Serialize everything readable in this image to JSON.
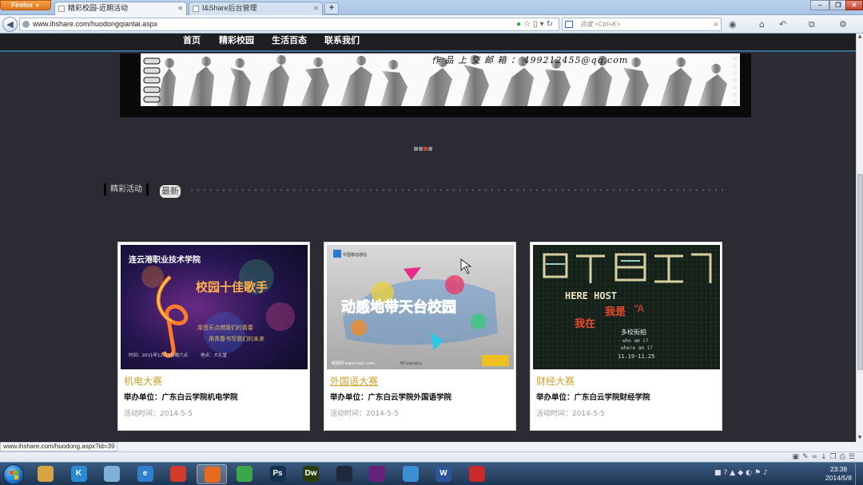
{
  "browser": {
    "menu_label": "Firefox",
    "tabs": [
      {
        "title": "精彩校园-近期活动",
        "active": true
      },
      {
        "title": "I&Share后台管理",
        "active": false
      }
    ],
    "new_tab_label": "+",
    "window_controls": {
      "minimize": "–",
      "maximize": "❐",
      "close": "✕"
    },
    "url": "www.ihshare.com/huodongqiantai.aspx",
    "search_placeholder": "百度 <Ctrl+K>",
    "status_url": "www.ihshare.com/huodong.aspx?id=39"
  },
  "site": {
    "nav": [
      "首页",
      "精彩校园",
      "生活百态",
      "联系我们"
    ],
    "banner_text": "作 品 上 交 邮 箱 ： 499212455@qq.com",
    "pager": {
      "count": 4,
      "active_index": 2
    },
    "section": {
      "title": "精彩活动",
      "tab": "最新"
    },
    "cards": [
      {
        "title": "机电大赛",
        "org": "举办单位：广东白云学院机电学院",
        "date": "活动时间：2014-5-5",
        "poster": {
          "school": "连云港职业技术学院",
          "headline": "校园十佳歌手",
          "line1": "用音乐点燃我们的青春",
          "line2": "用青春书写我们的未来",
          "time": "时间：2011年12月9日晚六点",
          "place": "地点：大礼堂"
        }
      },
      {
        "title": "外国语大赛",
        "org": "举办单位：广东白云学院外国语学院",
        "date": "活动时间：2014-5-5",
        "poster": {
          "headline": "动感地带天台校园",
          "logo_text": "中国移动通信",
          "site_text": "昵图网 www.nipic.com",
          "id_text": "BY:xiangliu"
        }
      },
      {
        "title": "财经大赛",
        "org": "举办单位：广东白云学院财经学院",
        "date": "活动时间：2014-5-5",
        "poster": {
          "big": "HERE HOST",
          "line1": "我是",
          "line2": "我在",
          "line3": "多校街拍",
          "line4": "who am i?",
          "line5": "where am i?",
          "line6": "11.19-11.25",
          "quote": "“A"
        }
      }
    ]
  },
  "taskbar": {
    "apps": [
      {
        "name": "file-explorer",
        "label": "",
        "color": "#d9a441"
      },
      {
        "name": "kugou",
        "label": "K",
        "color": "#2a8ad4"
      },
      {
        "name": "notepad",
        "label": "",
        "color": "#7fb0d8"
      },
      {
        "name": "ie",
        "label": "e",
        "color": "#2f7fd1"
      },
      {
        "name": "chrome",
        "label": "",
        "color": "#d33c2c"
      },
      {
        "name": "firefox",
        "label": "",
        "color": "#e56b1f"
      },
      {
        "name": "360",
        "label": "",
        "color": "#3aa84a"
      },
      {
        "name": "photoshop",
        "label": "Ps",
        "color": "#12324f"
      },
      {
        "name": "dreamweaver",
        "label": "Dw",
        "color": "#2c3d0c"
      },
      {
        "name": "inkscape",
        "label": "",
        "color": "#1e2a3a"
      },
      {
        "name": "visual-studio",
        "label": "",
        "color": "#68217a"
      },
      {
        "name": "network",
        "label": "",
        "color": "#3a8fd4"
      },
      {
        "name": "word",
        "label": "W",
        "color": "#2a5699"
      },
      {
        "name": "recorder",
        "label": "",
        "color": "#c82a2a"
      }
    ],
    "active_app": "firefox",
    "time": "23:38",
    "date": "2014/5/8"
  },
  "colors": {
    "page_bg": "#2b2b33",
    "card_title": "#c9a227",
    "date_text": "#999999",
    "pager_active": "#d23a2a"
  }
}
